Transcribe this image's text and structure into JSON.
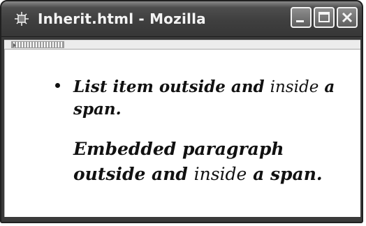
{
  "window": {
    "title": "Inherit.html - Mozilla"
  },
  "icons": {
    "app": "mozilla-star-icon",
    "minimize": "minimize-icon",
    "maximize": "maximize-icon",
    "close": "close-icon",
    "toolbar_grip": "toolbar-grip-icon"
  },
  "content": {
    "list_item_part_1": "List item outside and ",
    "list_item_part_2": "inside",
    "list_item_part_3": " a span.",
    "paragraph_part_1": "Embedded paragraph outside and ",
    "paragraph_part_2": "inside",
    "paragraph_part_3": " a span."
  }
}
